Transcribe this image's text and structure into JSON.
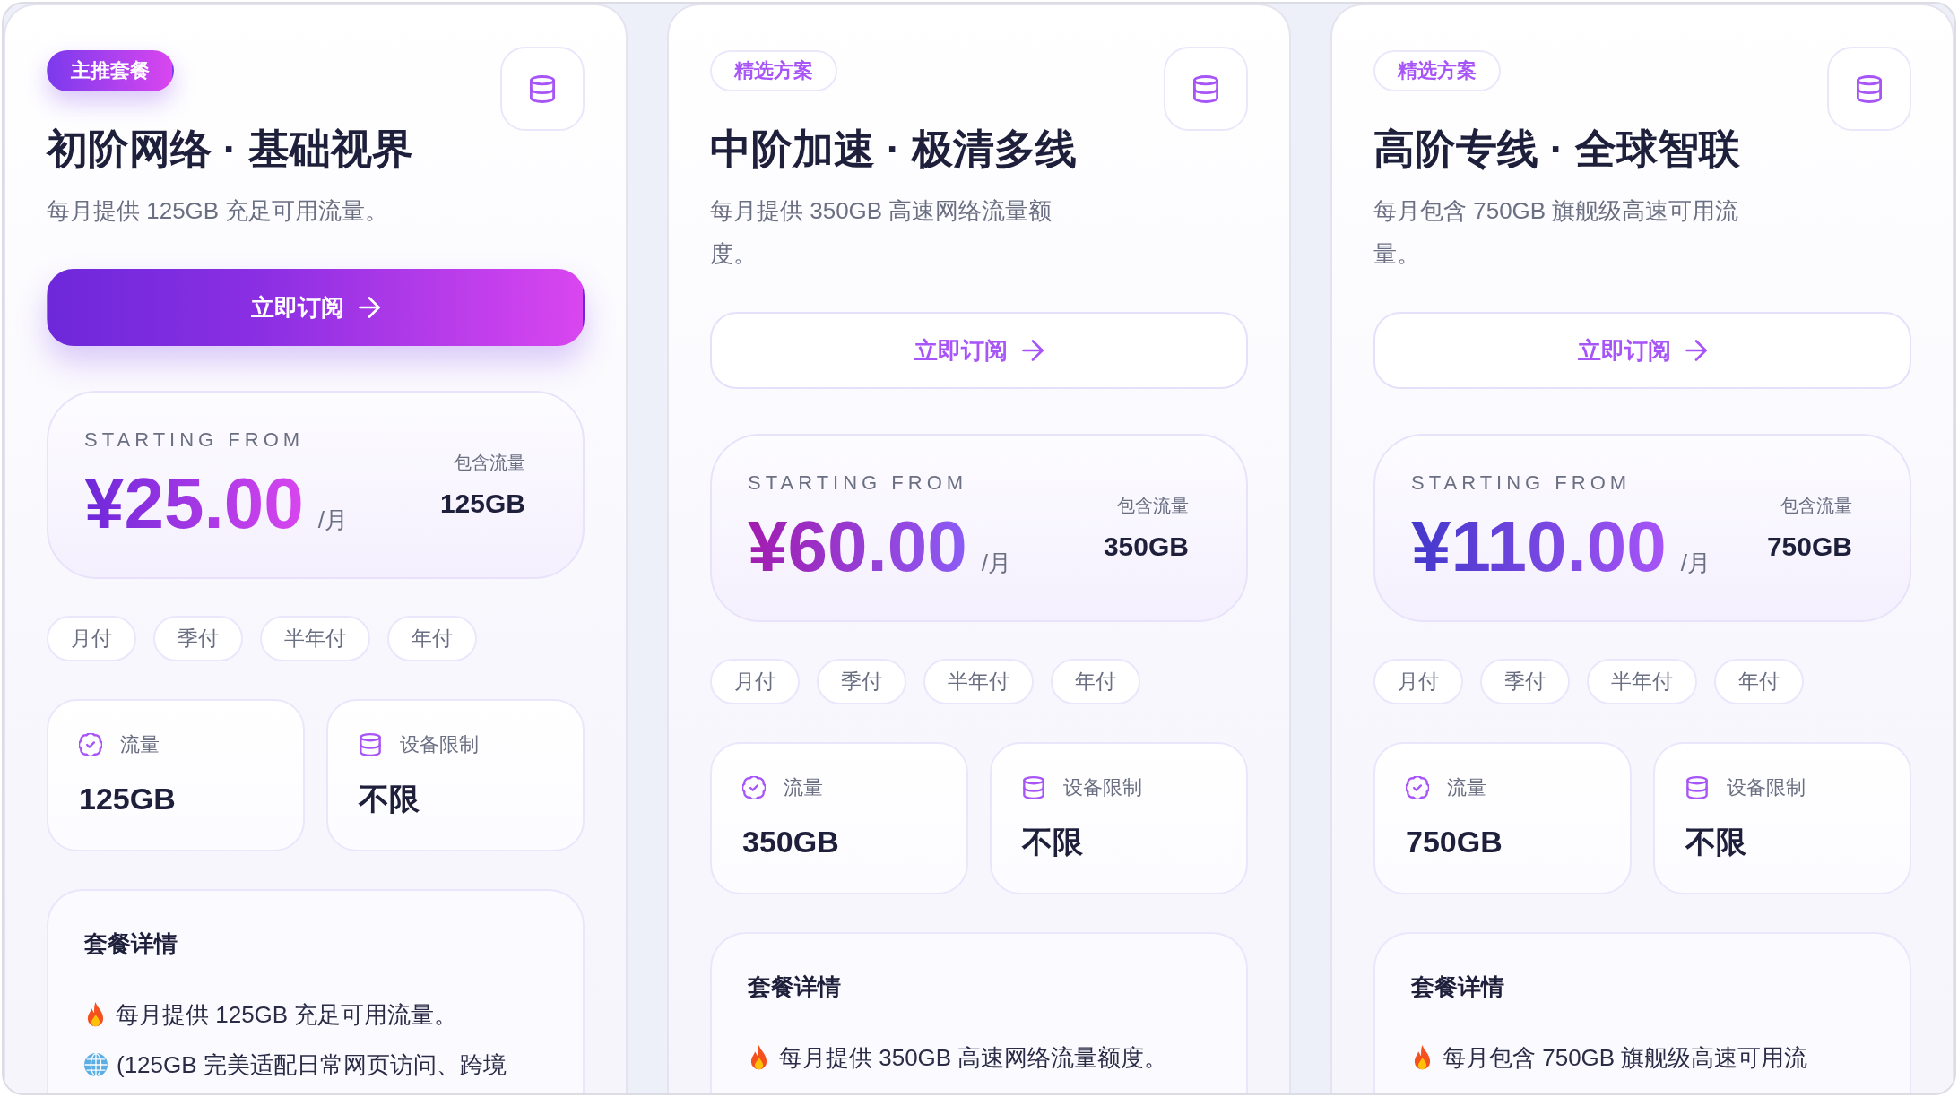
{
  "plans": [
    {
      "featured": true,
      "badge": "主推套餐",
      "title": "初阶网络 · 基础视界",
      "description": "每月提供 125GB 充足可用流量。",
      "subscribe_button": "立即订阅",
      "price": {
        "caption": "STARTING FROM",
        "amount": "¥25.00",
        "unit": "/月",
        "traffic_label": "包含流量",
        "traffic_value": "125GB"
      },
      "billing_options": [
        {
          "label": "月付",
          "selected": false
        },
        {
          "label": "季付",
          "selected": false
        },
        {
          "label": "半年付",
          "selected": false
        },
        {
          "label": "年付",
          "selected": false
        }
      ],
      "stats": [
        {
          "kind": "traffic",
          "label": "流量",
          "value": "125GB"
        },
        {
          "kind": "devices",
          "label": "设备限制",
          "value": "不限"
        }
      ],
      "details": {
        "title": "套餐详情",
        "items": [
          {
            "kind": "fire",
            "text": "每月提供 125GB 充足可用流量。"
          },
          {
            "kind": "globe",
            "text": "(125GB 完美适配日常网页访问、跨境"
          }
        ]
      }
    },
    {
      "featured": false,
      "badge": "精选方案",
      "title": "中阶加速 · 极清多线",
      "description": "每月提供 350GB 高速网络流量额度。",
      "subscribe_button": "立即订阅",
      "price": {
        "caption": "STARTING FROM",
        "amount": "¥60.00",
        "unit": "/月",
        "traffic_label": "包含流量",
        "traffic_value": "350GB"
      },
      "billing_options": [
        {
          "label": "月付",
          "selected": false
        },
        {
          "label": "季付",
          "selected": false
        },
        {
          "label": "半年付",
          "selected": false
        },
        {
          "label": "年付",
          "selected": false
        }
      ],
      "stats": [
        {
          "kind": "traffic",
          "label": "流量",
          "value": "350GB"
        },
        {
          "kind": "devices",
          "label": "设备限制",
          "value": "不限"
        }
      ],
      "details": {
        "title": "套餐详情",
        "items": [
          {
            "kind": "fire",
            "text": "每月提供 350GB 高速网络流量额度。"
          }
        ]
      }
    },
    {
      "featured": false,
      "badge": "精选方案",
      "title": "高阶专线 · 全球智联",
      "description": "每月包含 750GB 旗舰级高速可用流量。",
      "subscribe_button": "立即订阅",
      "price": {
        "caption": "STARTING FROM",
        "amount": "¥110.00",
        "unit": "/月",
        "traffic_label": "包含流量",
        "traffic_value": "750GB"
      },
      "billing_options": [
        {
          "label": "月付",
          "selected": false
        },
        {
          "label": "季付",
          "selected": false
        },
        {
          "label": "半年付",
          "selected": false
        },
        {
          "label": "年付",
          "selected": false
        }
      ],
      "stats": [
        {
          "kind": "traffic",
          "label": "流量",
          "value": "750GB"
        },
        {
          "kind": "devices",
          "label": "设备限制",
          "value": "不限"
        }
      ],
      "details": {
        "title": "套餐详情",
        "items": [
          {
            "kind": "fire",
            "text": "每月包含 750GB 旗舰级高速可用流"
          }
        ]
      }
    }
  ]
}
